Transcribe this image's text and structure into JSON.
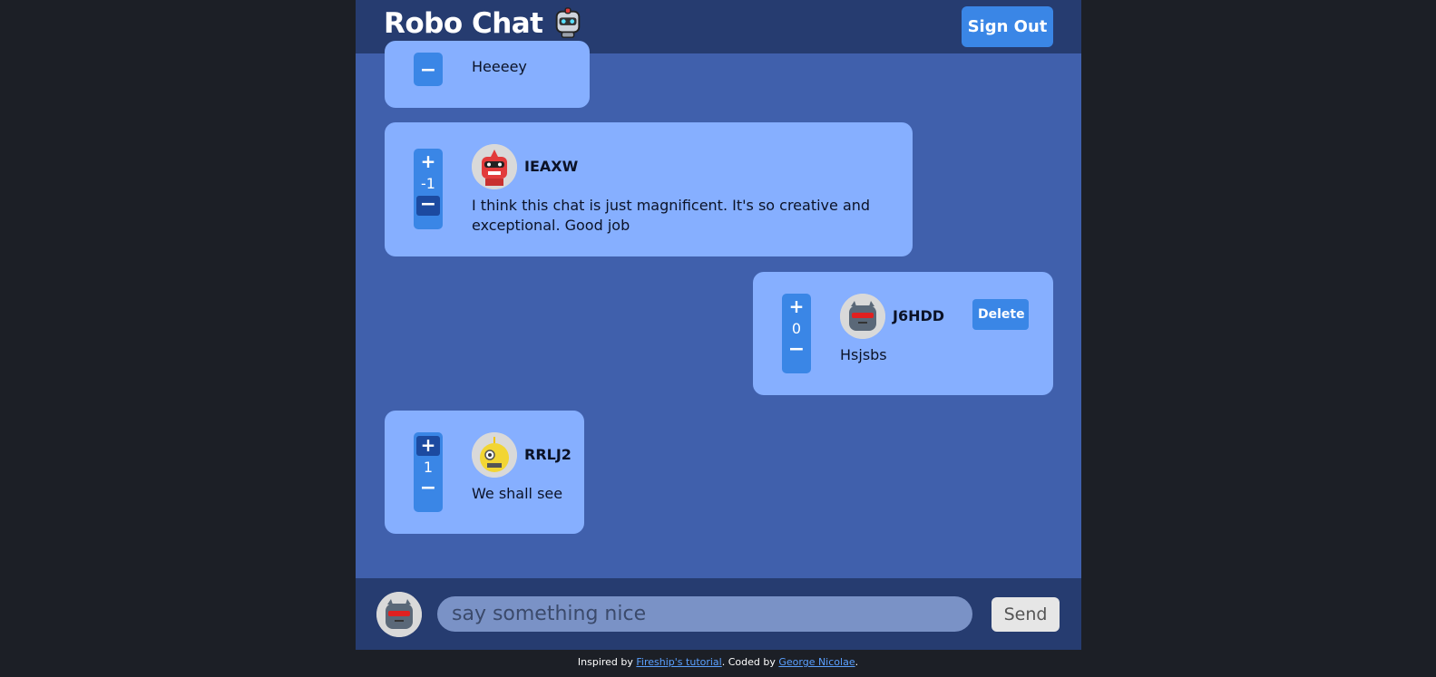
{
  "header": {
    "title": "Robo Chat",
    "brand_icon": "robot-emoji-icon",
    "signout_label": "Sign Out"
  },
  "messages": [
    {
      "score": "",
      "author": "",
      "text": "Heeeey"
    },
    {
      "score": "-1",
      "author": "IEAXW",
      "text": "I think this chat is just magnificent. It's so creative and exceptional. Good job",
      "avatar": "red-robot-avatar",
      "voted": "down"
    },
    {
      "score": "0",
      "author": "J6HDD",
      "text": "Hsjsbs",
      "avatar": "gray-robot-avatar",
      "delete_label": "Delete"
    },
    {
      "score": "1",
      "author": "RRLJ2",
      "text": "We shall see",
      "avatar": "yellow-robot-avatar",
      "voted": "up"
    }
  ],
  "vote": {
    "plus": "+",
    "minus": "−"
  },
  "composer": {
    "placeholder": "say something nice",
    "send_label": "Send"
  },
  "footer": {
    "inspired_prefix": "Inspired by ",
    "inspired_link": "Fireship's tutorial",
    "coded_prefix": ". Coded by ",
    "coded_link": "George Nicolae",
    "suffix": "."
  },
  "colors": {
    "page_bg": "#1c1f26",
    "chat_bg": "#4060ac",
    "header_bg": "#263c70",
    "bubble": "#86afff",
    "accent": "#3a86e6"
  }
}
